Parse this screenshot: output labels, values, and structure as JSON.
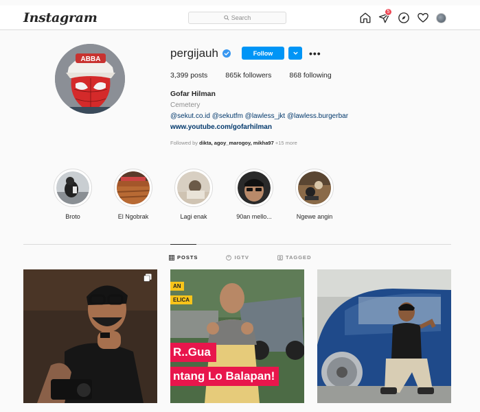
{
  "topbar": {
    "logo": "Instagram",
    "search_placeholder": "Search",
    "activity_badge": "5"
  },
  "profile": {
    "username": "pergijauh",
    "follow_label": "Follow",
    "more_label": "•••",
    "posts": "3,399 posts",
    "followers": "865k followers",
    "following": "868 following",
    "full_name": "Gofar Hilman",
    "category": "Cemetery",
    "bio_links": "@sekut.co.id @sekutfm @lawless_jkt @lawless.burgerbar",
    "website": "www.youtube.com/gofarhilman",
    "followed_by_prefix": "Followed by",
    "followed_by_names": "dikta, agoy_marogoy, mikha97",
    "followed_by_more": "+15 more"
  },
  "highlights": [
    {
      "label": "Broto"
    },
    {
      "label": "El Ngobrak"
    },
    {
      "label": "Lagi enak"
    },
    {
      "label": "90an mello..."
    },
    {
      "label": "Ngewe angin"
    }
  ],
  "tabs": [
    {
      "label": "POSTS",
      "icon": "grid-icon",
      "active": true
    },
    {
      "label": "IGTV",
      "icon": "igtv-icon",
      "active": false
    },
    {
      "label": "TAGGED",
      "icon": "tag-icon",
      "active": false
    }
  ],
  "posts": [
    {
      "kind": "multi-photo"
    },
    {
      "kind": "video",
      "tag1": "AN",
      "tag2": "ELICA",
      "caption1": "R..Gua",
      "caption2": "ntang Lo Balapan!"
    },
    {
      "kind": "photo"
    }
  ],
  "colors": {
    "accent": "#0095f6",
    "badge": "#ed4956",
    "link": "#00376b"
  }
}
